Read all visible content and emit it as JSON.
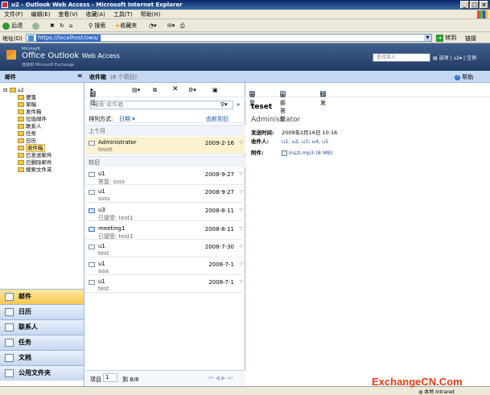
{
  "window": {
    "title": "u2 - Outlook Web Access - Microsoft Internet Explorer"
  },
  "menu": [
    "文件(F)",
    "编辑(E)",
    "查看(V)",
    "收藏(A)",
    "工具(T)",
    "帮助(H)"
  ],
  "toolbar": {
    "back": "后退",
    "search": "搜索",
    "favorites": "收藏夹"
  },
  "address": {
    "label": "地址(D)",
    "url": "https://localhost/owa/",
    "go": "转到",
    "links": "链接"
  },
  "owa": {
    "microsoft": "Microsoft",
    "brand_main": "Office Outlook",
    "brand_tail": "Web Access",
    "brand_sub": "连接到 Microsoft Exchange",
    "find_placeholder": "查找某人",
    "options": "选项",
    "user": "u2",
    "logout": "注销"
  },
  "strip": {
    "mail": "邮件",
    "collapse": "«",
    "folder": "收件箱",
    "count": "(8 个项目)",
    "help": "帮助"
  },
  "tree": {
    "root": "u2",
    "folders": [
      "便笺",
      "草稿",
      "发件箱",
      "垃圾邮件",
      "联系人",
      "任务",
      "日历",
      "收件箱",
      "已发送邮件",
      "已删除邮件",
      "搜索文件夹"
    ]
  },
  "nav": [
    "邮件",
    "日历",
    "联系人",
    "任务",
    "文档",
    "公用文件夹"
  ],
  "list": {
    "new": "新建",
    "search_placeholder": "搜索 收件箱",
    "sort_label": "排列方式:",
    "sort_field": "日期",
    "sort_order": "由新到旧",
    "group_1": "上个月",
    "group_2": "较旧",
    "messages": [
      {
        "sender": "Administrator",
        "date": "2009-2-16",
        "preview": "teset"
      },
      {
        "sender": "u1",
        "date": "2008-9-27",
        "preview": "答复: ssss"
      },
      {
        "sender": "u1",
        "date": "2008-9-27",
        "preview": "ssss"
      },
      {
        "sender": "u3",
        "date": "2008-8-11",
        "preview": "已接受: test1"
      },
      {
        "sender": "meeting1",
        "date": "2008-8-11",
        "preview": "已接受: test1"
      },
      {
        "sender": "u1",
        "date": "2008-7-30",
        "preview": "test"
      },
      {
        "sender": "u1",
        "date": "2008-7-1",
        "preview": "aaa"
      },
      {
        "sender": "u1",
        "date": "2008-7-1",
        "preview": "test"
      }
    ],
    "page_label": "项目",
    "page_value": "1",
    "page_range": "到 8/8"
  },
  "reading": {
    "reply": "答复",
    "reply_all": "全部答复",
    "forward": "转发",
    "subject": "teset",
    "from": "Administrator",
    "sent_label": "发送时间:",
    "sent_value": "2009年2月16日 10:16",
    "to_label": "收件人:",
    "to_value": "u1; u2; u3; u4; u5",
    "attach_label": "附件:",
    "attach_value": "inszl.mp3 (8 MB)"
  },
  "status": {
    "zone": "本地 Intranet"
  },
  "watermark": "ExchangeCN.Com"
}
